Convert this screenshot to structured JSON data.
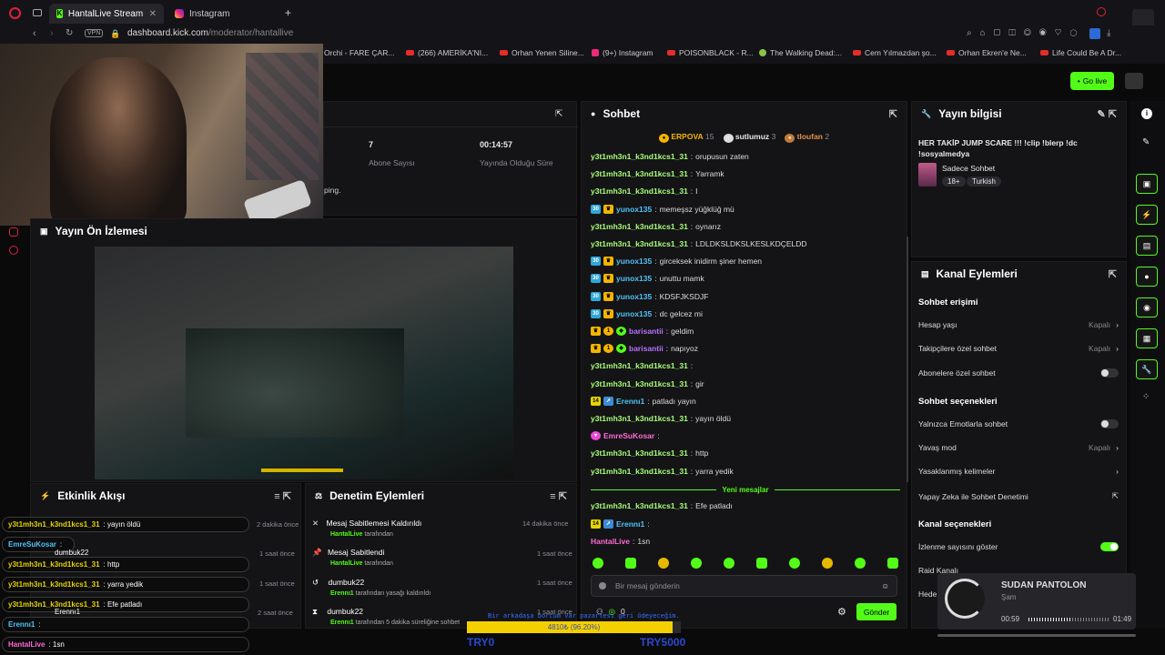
{
  "browser": {
    "tabs": [
      {
        "label": "HantalLive Stream - Kick D",
        "active": true
      },
      {
        "label": "Instagram",
        "active": false
      }
    ],
    "url_domain": "dashboard.kick.com",
    "url_path": "/moderator/hantallive",
    "vpn_label": "VPN",
    "bookmarks": [
      "Orchi - FARE ÇAR...",
      "(266) AMERİKA'NI...",
      "Orhan Yenen Siline...",
      "(9+) Instagram",
      "POISONBLACK - R...",
      "The Walking Dead:...",
      "Cem Yılmazdan şo...",
      "Orhan Ekren'e Ne...",
      "Life Could Be A Dr..."
    ]
  },
  "header": {
    "go_live": "Go live"
  },
  "stats": {
    "subs_value": "7",
    "subs_label": "Abone Sayısı",
    "uptime_value": "00:14:57",
    "uptime_label": "Yayında Olduğu Süre",
    "ping_fragment": "ping."
  },
  "preview": {
    "title": "Yayın Ön İzlemesi"
  },
  "activity": {
    "title": "Etkinlik Akışı"
  },
  "moderation": {
    "title": "Denetim Eylemleri",
    "items": [
      {
        "title": "Mesaj Sabitlemesi Kaldırıldı",
        "actor": "HantalLive",
        "suffix": "tarafından",
        "time": "14 dakika önce"
      },
      {
        "title": "Mesaj Sabitlendi",
        "actor": "HantalLive",
        "suffix": "tarafından",
        "time": "1 saat önce"
      },
      {
        "title": "dumbuk22",
        "actor": "Erennı1",
        "suffix": "tarafından yasağı kaldırıldı",
        "time": "1 saat önce"
      },
      {
        "title": "dumbuk22",
        "actor": "Erennı1",
        "suffix": "tarafından 5 dakika süreliğine sohbet",
        "time": "1 saat önce"
      }
    ]
  },
  "activity_feed": [
    {
      "time": "2 dakika önce",
      "user": "dumbuk22",
      "note": "komedi zurna aldığı"
    },
    {
      "time": "1 saat önce",
      "user": "",
      "note": ""
    },
    {
      "time": "1 saat önce",
      "user": "",
      "note": "istek şarkı aldığı"
    },
    {
      "time": "2 saat önce",
      "user": "Erennı1",
      "note": "istek şarkı aldığı"
    }
  ],
  "chat": {
    "title": "Sohbet",
    "leaders": [
      {
        "name": "ERPOVA",
        "count": "15"
      },
      {
        "name": "sutlumuz",
        "count": "3"
      },
      {
        "name": "tloufan",
        "count": "2"
      }
    ],
    "messages": [
      {
        "user": "y3t1mh3n1_k3nd1kcs1_31",
        "text": "orupusun zaten",
        "style": "green",
        "badges": []
      },
      {
        "user": "y3t1mh3n1_k3nd1kcs1_31",
        "text": "Yarramk",
        "style": "green",
        "badges": []
      },
      {
        "user": "y3t1mh3n1_k3nd1kcs1_31",
        "text": "I",
        "style": "green",
        "badges": []
      },
      {
        "user": "yunox135",
        "text": "memeşsz yüğklüğ mü",
        "style": "blue",
        "badges": [
          "30",
          "c"
        ]
      },
      {
        "user": "y3t1mh3n1_k3nd1kcs1_31",
        "text": "oynarız",
        "style": "green",
        "badges": []
      },
      {
        "user": "y3t1mh3n1_k3nd1kcs1_31",
        "text": "LDLDKSLDKSLKESLKDÇELDD",
        "style": "green",
        "badges": []
      },
      {
        "user": "yunox135",
        "text": "girceksek inidirm şiner hemen",
        "style": "blue",
        "badges": [
          "30",
          "c"
        ]
      },
      {
        "user": "yunox135",
        "text": "unuttu mamk",
        "style": "blue",
        "badges": [
          "30",
          "c"
        ]
      },
      {
        "user": "yunox135",
        "text": "KDSFJKSDJF",
        "style": "blue",
        "badges": [
          "30",
          "c"
        ]
      },
      {
        "user": "yunox135",
        "text": "dc gelcez mi",
        "style": "blue",
        "badges": [
          "30",
          "c"
        ]
      },
      {
        "user": "barisantii",
        "text": "geldim",
        "style": "purple",
        "badges": [
          "c",
          "1",
          "g"
        ]
      },
      {
        "user": "barisantii",
        "text": "napıyoz",
        "style": "purple",
        "badges": [
          "c",
          "1",
          "g"
        ]
      },
      {
        "user": "y3t1mh3n1_k3nd1kcs1_31",
        "text": "",
        "style": "green",
        "badges": []
      },
      {
        "user": "y3t1mh3n1_k3nd1kcs1_31",
        "text": "gir",
        "style": "green",
        "badges": []
      },
      {
        "user": "Erennı1",
        "text": "patladı yayın",
        "style": "blue",
        "badges": [
          "14",
          "b"
        ]
      },
      {
        "user": "y3t1mh3n1_k3nd1kcs1_31",
        "text": "yayın öldü",
        "style": "green",
        "badges": []
      },
      {
        "user": "EmreSuKosar",
        "text": "",
        "style": "pink",
        "badges": [
          "p"
        ]
      },
      {
        "user": "y3t1mh3n1_k3nd1kcs1_31",
        "text": "http",
        "style": "green",
        "badges": []
      },
      {
        "user": "y3t1mh3n1_k3nd1kcs1_31",
        "text": "yarra yedik",
        "style": "green",
        "badges": []
      }
    ],
    "new_messages": "Yeni mesajlar",
    "after": [
      {
        "user": "y3t1mh3n1_k3nd1kcs1_31",
        "text": "Efe patladı",
        "style": "green",
        "badges": []
      },
      {
        "user": "Erennı1",
        "text": "",
        "style": "blue",
        "badges": [
          "14",
          "b"
        ]
      },
      {
        "user": "HantalLive",
        "text": "1sn",
        "style": "pink",
        "badges": []
      }
    ],
    "input_placeholder": "Bir mesaj gönderin",
    "points": "0",
    "send": "Gönder"
  },
  "stream_info": {
    "title": "Yayın bilgisi",
    "stream_title": "HER TAKİP JUMP SCARE !!! !clip !blerp !dc !sosyalmedya",
    "category": "Sadece Sohbet",
    "tags": [
      "18+",
      "Turkish"
    ]
  },
  "channel_actions": {
    "title": "Kanal Eylemleri",
    "chat_access": "Sohbet erişimi",
    "account_age": "Hesap yaşı",
    "account_age_val": "Kapalı",
    "followers_only": "Takipçilere özel sohbet",
    "followers_only_val": "Kapalı",
    "subs_only": "Abonelere özel sohbet",
    "chat_options": "Sohbet seçenekleri",
    "emote_only": "Yalnızca Emotlarla sohbet",
    "slow_mode": "Yavaş mod",
    "slow_mode_val": "Kapalı",
    "banned_words": "Yasaklanmış kelimeler",
    "ai_moderation": "Yapay Zeka ile Sohbet Denetimi",
    "channel_options": "Kanal seçenekleri",
    "show_viewers": "İzlenme sayısını göster",
    "raid_channel": "Raid Kanalı",
    "host_fragment": "Hede"
  },
  "overlay_chat": [
    {
      "user": "y3t1mh3n1_k3nd1kcs1_31",
      "text": ": yayın öldü"
    },
    {
      "user": "EmreSuKosar",
      "text": ":"
    },
    {
      "user": "y3t1mh3n1_k3nd1kcs1_31",
      "text": ": http"
    },
    {
      "user": "y3t1mh3n1_k3nd1kcs1_31",
      "text": ": yarra yedik"
    },
    {
      "user": "y3t1mh3n1_k3nd1kcs1_31",
      "text": ": Efe patladı"
    },
    {
      "user": "Erennı1",
      "text": ":"
    },
    {
      "user": "HantalLive",
      "text": ": 1sn"
    }
  ],
  "overlay_extra": {
    "dumbuk": "dumbuk22",
    "erenn": "Erennı1"
  },
  "goal": {
    "banner": "Bir arkadaşa borcum var pazartesi geri ödeyeceğim.",
    "progress_text": "4810₺ (96.20%)",
    "progress_fraction": 0.962,
    "left": "TRY0",
    "right": "TRY5000"
  },
  "music": {
    "title": "SUDAN PANTOLON",
    "artist": "Şam",
    "elapsed": "00:59",
    "total": "01:49",
    "progress_fraction": 0.54
  }
}
